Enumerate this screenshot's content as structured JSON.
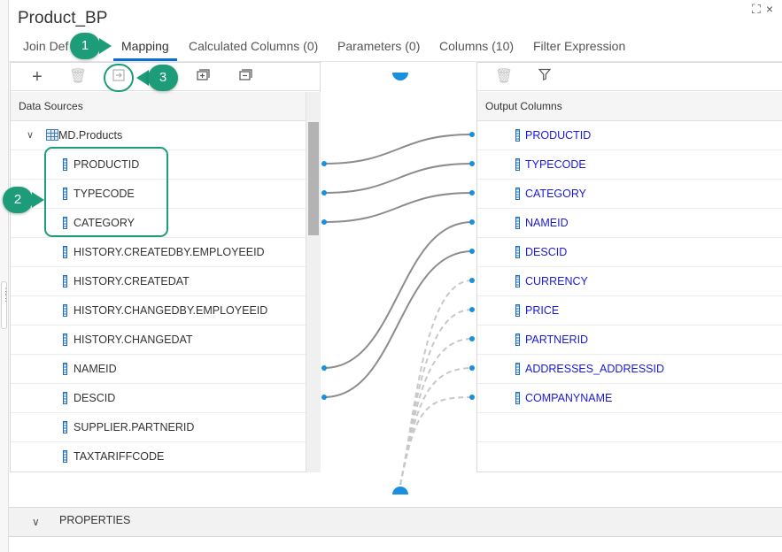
{
  "window": {
    "title": "Product_BP"
  },
  "tabs": [
    {
      "label": "Join Def"
    },
    {
      "label": "Mapping"
    },
    {
      "label": "Calculated Columns (0)"
    },
    {
      "label": "Parameters (0)"
    },
    {
      "label": "Columns (10)"
    },
    {
      "label": "Filter Expression"
    }
  ],
  "active_tab": "Mapping",
  "source_panel": {
    "header": "Data Sources",
    "toolbar_icons": [
      "add-icon",
      "delete-icon",
      "add-to-output-icon",
      "expand-icon",
      "collapse-icon"
    ],
    "group": {
      "label": "MD.Products",
      "icon": "table-icon"
    },
    "columns": [
      "PRODUCTID",
      "TYPECODE",
      "CATEGORY",
      "HISTORY.CREATEDBY.EMPLOYEEID",
      "HISTORY.CREATEDAT",
      "HISTORY.CHANGEDBY.EMPLOYEEID",
      "HISTORY.CHANGEDAT",
      "NAMEID",
      "DESCID",
      "SUPPLIER.PARTNERID",
      "TAXTARIFFCODE"
    ]
  },
  "output_panel": {
    "header": "Output Columns",
    "toolbar_icons": [
      "delete-icon",
      "filter-icon"
    ],
    "columns": [
      "PRODUCTID",
      "TYPECODE",
      "CATEGORY",
      "NAMEID",
      "DESCID",
      "CURRENCY",
      "PRICE",
      "PARTNERID",
      "ADDRESSES_ADDRESSID",
      "COMPANYNAME"
    ]
  },
  "mappings": [
    {
      "from": "PRODUCTID",
      "to": "PRODUCTID"
    },
    {
      "from": "TYPECODE",
      "to": "TYPECODE"
    },
    {
      "from": "CATEGORY",
      "to": "CATEGORY"
    },
    {
      "from": "NAMEID",
      "to": "NAMEID"
    },
    {
      "from": "DESCID",
      "to": "DESCID"
    }
  ],
  "unmapped_visible_links": [
    "CURRENCY",
    "PRICE",
    "PARTNERID",
    "ADDRESSES_ADDRESSID",
    "COMPANYNAME"
  ],
  "properties_section": {
    "label": "PROPERTIES"
  },
  "callouts": [
    {
      "number": "1"
    },
    {
      "number": "2"
    },
    {
      "number": "3"
    }
  ],
  "colors": {
    "accent": "#0a6ed1",
    "callout": "#1d9c7a",
    "output_link_text": "#1a1ad6",
    "mapping_line": "#8c8c8c",
    "mapping_dot": "#1a8fdf"
  }
}
